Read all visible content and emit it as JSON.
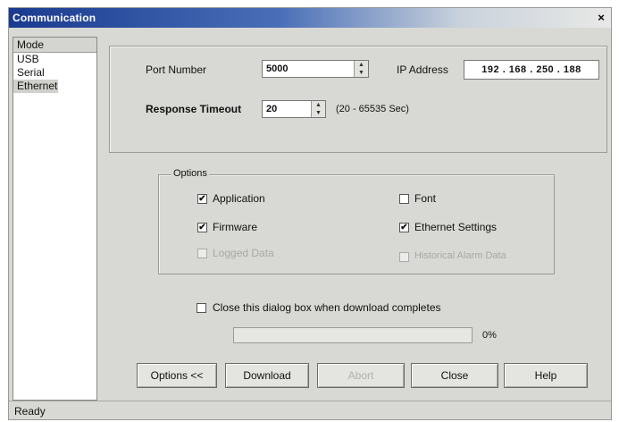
{
  "window": {
    "title": "Communication",
    "close_glyph": "×"
  },
  "mode_panel": {
    "header": "Mode",
    "items": [
      "USB",
      "Serial",
      "Ethernet"
    ],
    "selected": "Ethernet"
  },
  "connection": {
    "port_label": "Port Number",
    "port_value": "5000",
    "ip_label": "IP Address",
    "ip_value": "192 . 168 . 250 . 188",
    "timeout_label": "Response Timeout",
    "timeout_value": "20",
    "timeout_range": "(20 - 65535 Sec)"
  },
  "options": {
    "legend": "Options",
    "items": [
      {
        "label": "Application",
        "checked": true,
        "enabled": true
      },
      {
        "label": "Font",
        "checked": false,
        "enabled": true
      },
      {
        "label": "Firmware",
        "checked": true,
        "enabled": true
      },
      {
        "label": "Ethernet Settings",
        "checked": true,
        "enabled": true
      },
      {
        "label": "Logged Data",
        "checked": false,
        "enabled": false
      },
      {
        "label": "Historical Alarm Data",
        "checked": false,
        "enabled": false
      }
    ]
  },
  "close_dialog": {
    "label": "Close this dialog box when download completes",
    "checked": false
  },
  "progress": {
    "value": 0,
    "text": "0%"
  },
  "buttons": {
    "options": "Options <<",
    "download": "Download",
    "abort": "Abort",
    "close": "Close",
    "help": "Help"
  },
  "status": {
    "text": "Ready"
  },
  "colors": {
    "title_active": "#1a3a8f",
    "progress_fill": "#3a5fb0"
  },
  "icons": {
    "spin_up": "▲",
    "spin_down": "▼",
    "check": "✔"
  }
}
